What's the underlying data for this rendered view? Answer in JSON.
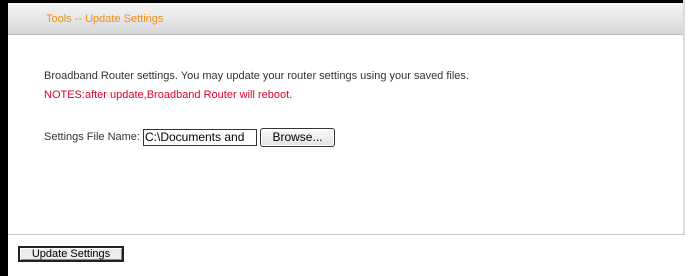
{
  "header": {
    "title": "Tools -- Update Settings"
  },
  "main": {
    "description": "Broadband Router settings. You may update your router settings using your saved files.",
    "note": "NOTES:after update,Broadband Router will reboot.",
    "settings_file": {
      "label": "Settings File Name:",
      "value": "C:\\Documents and",
      "browse_label": "Browse..."
    }
  },
  "footer": {
    "update_label": "Update Settings"
  },
  "colors": {
    "title": "#f08c16",
    "note": "#e0002a"
  }
}
